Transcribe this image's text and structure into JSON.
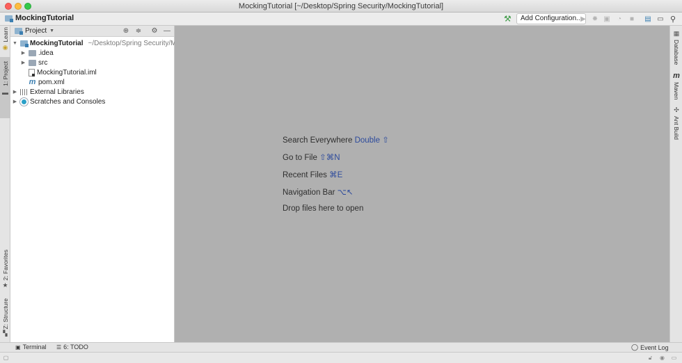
{
  "window": {
    "title": "MockingTutorial [~/Desktop/Spring Security/MockingTutorial]"
  },
  "navbar": {
    "project_name": "MockingTutorial",
    "add_configuration": "Add Configuration...",
    "icons": [
      "build-hammer-icon",
      "run-icon",
      "debug-icon",
      "coverage-icon",
      "profile-icon",
      "stop-icon",
      "project-structure-icon",
      "sdk-icon",
      "search-icon"
    ]
  },
  "left_tools": {
    "learn": "Learn",
    "project": "1: Project",
    "favorites": "2: Favorites",
    "structure": "Z: Structure"
  },
  "right_tools": {
    "database": "Database",
    "maven": "Maven",
    "ant_build": "Ant Build"
  },
  "project_panel": {
    "title": "Project",
    "tree": [
      {
        "label": "MockingTutorial",
        "path": "~/Desktop/Spring Security/Mo",
        "icon": "module-folder-icon"
      },
      {
        "label": ".idea",
        "icon": "folder-icon"
      },
      {
        "label": "src",
        "icon": "folder-icon"
      },
      {
        "label": "MockingTutorial.iml",
        "icon": "iml-file-icon"
      },
      {
        "label": "pom.xml",
        "icon": "maven-icon"
      },
      {
        "label": "External Libraries",
        "icon": "library-icon"
      },
      {
        "label": "Scratches and Consoles",
        "icon": "scratches-icon"
      }
    ]
  },
  "editor": {
    "hints": [
      {
        "text": "Search Everywhere",
        "shortcut": "Double ⇧"
      },
      {
        "text": "Go to File",
        "shortcut": "⇧⌘N"
      },
      {
        "text": "Recent Files",
        "shortcut": "⌘E"
      },
      {
        "text": "Navigation Bar",
        "shortcut": "⌥↖"
      },
      {
        "text": "Drop files here to open",
        "shortcut": ""
      }
    ]
  },
  "bottom_bar": {
    "terminal": "Terminal",
    "todo": "6: TODO",
    "event_log": "Event Log"
  }
}
